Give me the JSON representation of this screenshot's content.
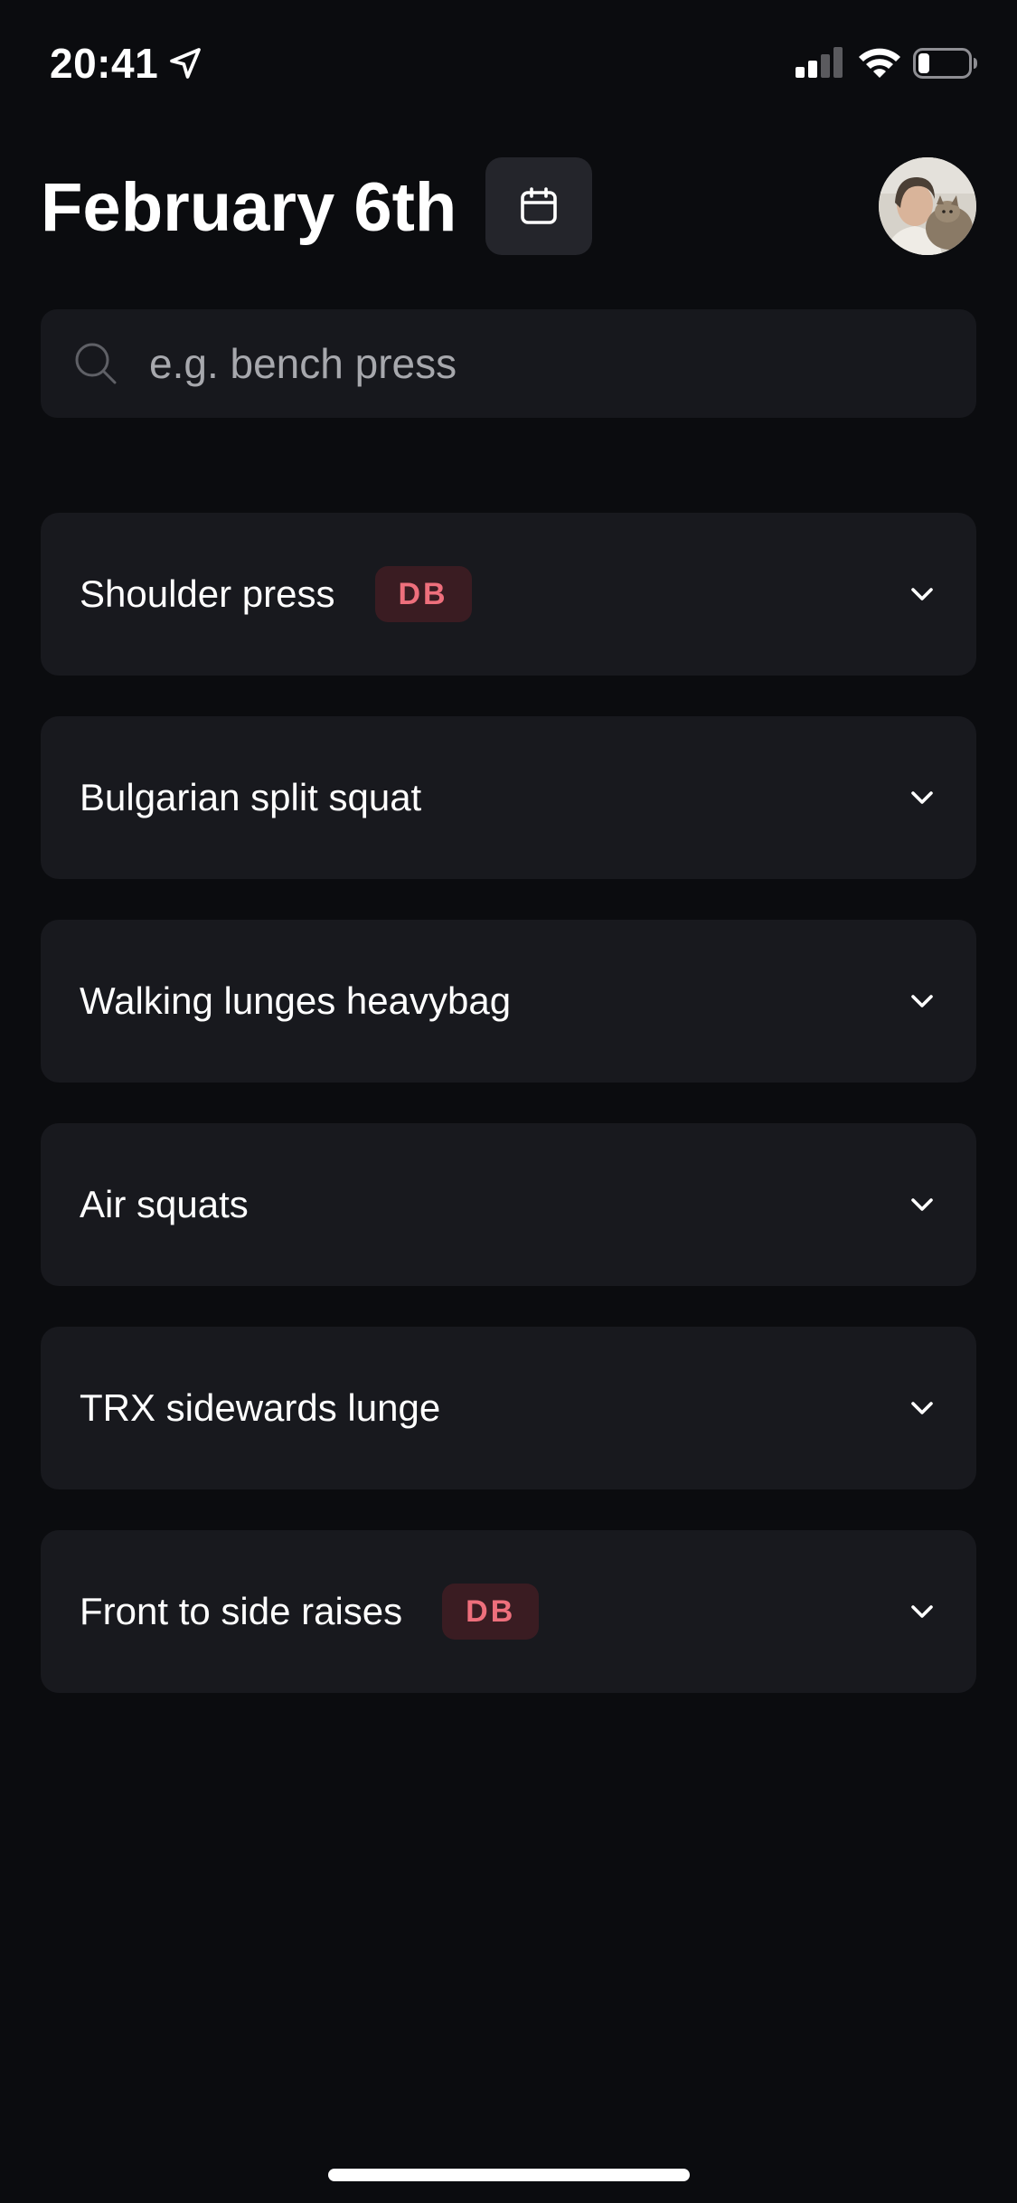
{
  "status_bar": {
    "time": "20:41",
    "icons": [
      "location-arrow-icon",
      "cellular-signal-icon",
      "wifi-icon",
      "battery-icon"
    ],
    "battery_level": 0.2,
    "signal_bars": 2
  },
  "header": {
    "title": "February 6th",
    "calendar_icon": "calendar-icon",
    "avatar_alt": "avatar"
  },
  "search": {
    "placeholder": "e.g. bench press",
    "value": "",
    "icon": "search-icon"
  },
  "exercises": [
    {
      "name": "Shoulder press",
      "badge": "DB"
    },
    {
      "name": "Bulgarian split squat",
      "badge": null
    },
    {
      "name": "Walking lunges heavybag",
      "badge": null
    },
    {
      "name": "Air squats",
      "badge": null
    },
    {
      "name": "TRX sidewards lunge",
      "badge": null
    },
    {
      "name": "Front to side raises",
      "badge": "DB"
    }
  ],
  "colors": {
    "background": "#0b0c0f",
    "card": "#18191e",
    "badge_bg": "#3a1c22",
    "badge_text": "#ee6f7c",
    "calendar_button": "#24252b"
  }
}
